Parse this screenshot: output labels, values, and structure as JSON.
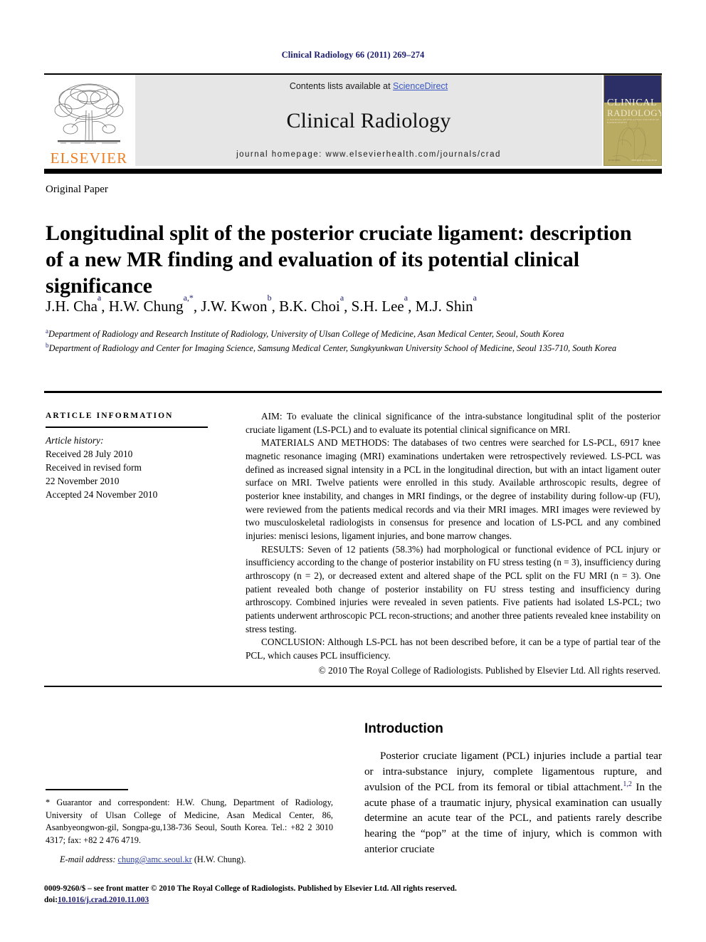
{
  "running_head": "Clinical Radiology 66 (2011) 269–274",
  "header": {
    "contents_prefix": "Contents lists available at ",
    "sciencedirect": "ScienceDirect",
    "journal_name": "Clinical Radiology",
    "homepage": "journal homepage: www.elsevierhealth.com/journals/crad",
    "elsevier_wordmark": "ELSEVIER",
    "cover": {
      "line1": "CLINICAL",
      "line2": "RADIOLOGY",
      "line3": "A JOURNAL OF THE ROYAL COLLEGE OF RADIOLOGISTS",
      "footer_left": "ELSEVIER",
      "footer_right": "THE ROYAL COLLEGE"
    },
    "link_color": "#3a57c4"
  },
  "article_type": "Original Paper",
  "title": "Longitudinal split of the posterior cruciate ligament: description of a new MR finding and evaluation of its potential clinical significance",
  "authors": [
    {
      "name": "J.H. Cha",
      "sup": "a",
      "sep": ", "
    },
    {
      "name": "H.W. Chung",
      "sup": "a,",
      "star": "*",
      "sep": ", "
    },
    {
      "name": "J.W. Kwon",
      "sup": "b",
      "sep": ", "
    },
    {
      "name": "B.K. Choi",
      "sup": "a",
      "sep": ", "
    },
    {
      "name": "S.H. Lee",
      "sup": "a",
      "sep": ", "
    },
    {
      "name": "M.J. Shin",
      "sup": "a",
      "sep": ""
    }
  ],
  "affiliations": [
    {
      "marker": "a",
      "text": "Department of Radiology and Research Institute of Radiology, University of Ulsan College of Medicine, Asan Medical Center, Seoul, South Korea"
    },
    {
      "marker": "b",
      "text": "Department of Radiology and Center for Imaging Science, Samsung Medical Center, Sungkyunkwan University School of Medicine, Seoul 135-710, South Korea"
    }
  ],
  "article_information": {
    "heading": "Article information",
    "history_label": "Article history:",
    "lines": [
      "Received 28 July 2010",
      "Received in revised form",
      "22 November 2010",
      "Accepted 24 November 2010"
    ]
  },
  "abstract": {
    "aim": "AIM: To evaluate the clinical significance of the intra-substance longitudinal split of the posterior cruciate ligament (LS-PCL) and to evaluate its potential clinical significance on MRI.",
    "materials_and_methods": "MATERIALS AND METHODS: The databases of two centres were searched for LS-PCL, 6917 knee magnetic resonance imaging (MRI) examinations undertaken were retrospectively reviewed. LS-PCL was defined as increased signal intensity in a PCL in the longitudinal direction, but with an intact ligament outer surface on MRI. Twelve patients were enrolled in this study. Available arthroscopic results, degree of posterior knee instability, and changes in MRI findings, or the degree of instability during follow-up (FU), were reviewed from the patients medical records and via their MRI images. MRI images were reviewed by two musculoskeletal radiologists in consensus for presence and location of LS-PCL and any combined injuries: menisci lesions, ligament injuries, and bone marrow changes.",
    "results": "RESULTS: Seven of 12 patients (58.3%) had morphological or functional evidence of PCL injury or insufficiency according to the change of posterior instability on FU stress testing (n = 3), insufficiency during arthroscopy (n = 2), or decreased extent and altered shape of the PCL split on the FU MRI (n = 3). One patient revealed both change of posterior instability on FU stress testing and insufficiency during arthroscopy. Combined injuries were revealed in seven patients. Five patients had isolated LS-PCL; two patients underwent arthroscopic PCL recon-structions; and another three patients revealed knee instability on stress testing.",
    "conclusion": "CONCLUSION: Although LS-PCL has not been described before, it can be a type of partial tear of the PCL, which causes PCL insufficiency.",
    "copyright": "© 2010 The Royal College of Radiologists. Published by Elsevier Ltd. All rights reserved."
  },
  "introduction": {
    "heading": "Introduction",
    "paragraph_part1": "Posterior cruciate ligament (PCL) injuries include a partial tear or intra-substance injury, complete ligamentous rupture, and avulsion of the PCL from its femoral or tibial attachment.",
    "citation": "1,2",
    "paragraph_part2": " In the acute phase of a traumatic injury, physical examination can usually determine an acute tear of the PCL, and patients rarely describe hearing the “pop” at the time of injury, which is common with anterior cruciate"
  },
  "footnote": {
    "correspondence": "* Guarantor and correspondent: H.W. Chung, Department of Radiology, University of Ulsan College of Medicine, Asan Medical Center, 86, Asanbyeongwon-gil, Songpa-gu,138-736 Seoul, South Korea. Tel.: +82 2 3010 4317; fax: +82 2 476 4719.",
    "email_label": "E-mail address:",
    "email": "chung@amc.seoul.kr",
    "email_owner": "(H.W. Chung)."
  },
  "issn_block": {
    "line1": "0009-9260/$ – see front matter © 2010 The Royal College of Radiologists. Published by Elsevier Ltd. All rights reserved.",
    "doi_label": "doi:",
    "doi": "10.1016/j.crad.2010.11.003"
  }
}
